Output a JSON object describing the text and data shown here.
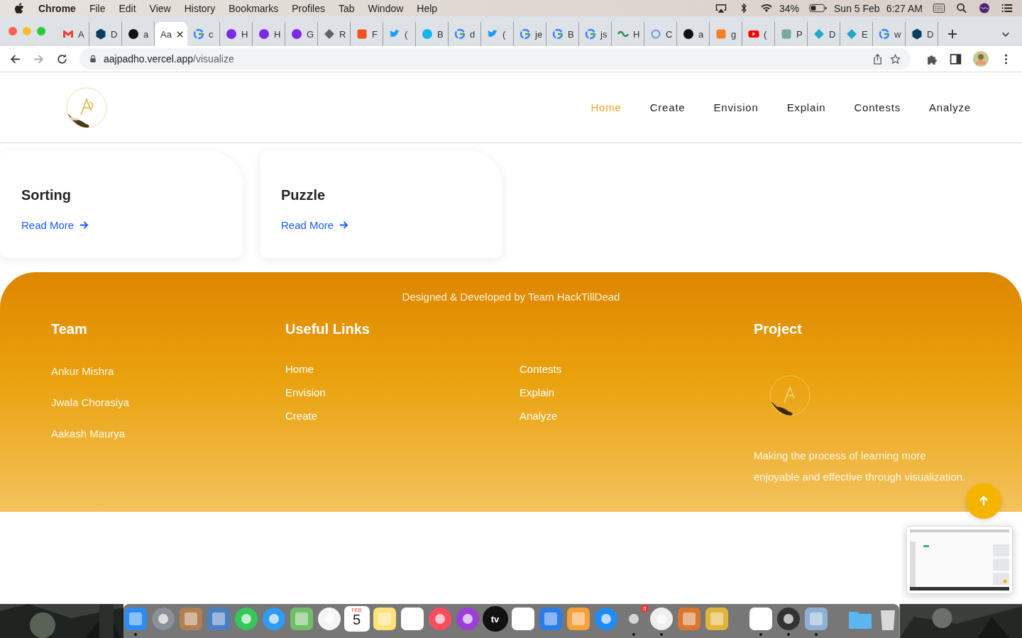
{
  "menu_bar": {
    "app": "Chrome",
    "menus": [
      "File",
      "Edit",
      "View",
      "History",
      "Bookmarks",
      "Profiles",
      "Tab",
      "Window",
      "Help"
    ],
    "battery": "34%",
    "date": "Sun 5 Feb",
    "time": "6:27 AM"
  },
  "tabs": [
    {
      "title": "A",
      "selected": false
    },
    {
      "title": "D",
      "selected": false
    },
    {
      "title": "a",
      "selected": false
    },
    {
      "title": "Aa",
      "selected": true
    },
    {
      "title": "c",
      "selected": false
    },
    {
      "title": "H",
      "selected": false
    },
    {
      "title": "H",
      "selected": false
    },
    {
      "title": "G",
      "selected": false
    },
    {
      "title": "R",
      "selected": false
    },
    {
      "title": "F",
      "selected": false
    },
    {
      "title": "(",
      "selected": false
    },
    {
      "title": "B",
      "selected": false
    },
    {
      "title": "d",
      "selected": false
    },
    {
      "title": "(",
      "selected": false
    },
    {
      "title": "je",
      "selected": false
    },
    {
      "title": "B",
      "selected": false
    },
    {
      "title": "js",
      "selected": false
    },
    {
      "title": "H",
      "selected": false
    },
    {
      "title": "C",
      "selected": false
    },
    {
      "title": "a",
      "selected": false
    },
    {
      "title": "g",
      "selected": false
    },
    {
      "title": "(",
      "selected": false
    },
    {
      "title": "P",
      "selected": false
    },
    {
      "title": "D",
      "selected": false
    },
    {
      "title": "E",
      "selected": false
    },
    {
      "title": "w",
      "selected": false
    },
    {
      "title": "D",
      "selected": false
    }
  ],
  "address_bar": {
    "domain": "aajpadho.vercel.app",
    "path": "/visualize"
  },
  "site_nav": [
    {
      "label": "Home",
      "selected": true
    },
    {
      "label": "Create",
      "selected": false
    },
    {
      "label": "Envision",
      "selected": false
    },
    {
      "label": "Explain",
      "selected": false
    },
    {
      "label": "Contests",
      "selected": false
    },
    {
      "label": "Analyze",
      "selected": false
    }
  ],
  "cards": [
    {
      "title": "Sorting",
      "link": "Read More"
    },
    {
      "title": "Puzzle",
      "link": "Read More"
    }
  ],
  "footer": {
    "credit": "Designed & Developed by Team HackTillDead",
    "team": {
      "heading": "Team",
      "members": [
        "Ankur Mishra",
        "Jwala Chorasiya",
        "Aakash Maurya"
      ]
    },
    "useful_links": {
      "heading": "Useful Links",
      "columns": [
        [
          "Home",
          "Envision",
          "Create"
        ],
        [
          "Contests",
          "Explain",
          "Analyze"
        ]
      ]
    },
    "project": {
      "heading": "Project",
      "description": "Making the process of learning more enjoyable and effective through visualization."
    }
  },
  "dock": [
    {
      "kind": "app",
      "running": true
    },
    {
      "kind": "app",
      "running": false
    },
    {
      "kind": "app",
      "running": false
    },
    {
      "kind": "app",
      "running": false
    },
    {
      "kind": "app",
      "running": false
    },
    {
      "kind": "app",
      "running": false
    },
    {
      "kind": "app",
      "running": false
    },
    {
      "kind": "app",
      "running": false
    },
    {
      "kind": "calendar",
      "month": "FEB",
      "day": "5",
      "running": false
    },
    {
      "kind": "app",
      "running": false
    },
    {
      "kind": "app",
      "running": false
    },
    {
      "kind": "app",
      "running": false
    },
    {
      "kind": "app",
      "running": false
    },
    {
      "kind": "tv",
      "label": "tv",
      "running": false
    },
    {
      "kind": "app",
      "running": false
    },
    {
      "kind": "app",
      "running": false
    },
    {
      "kind": "app",
      "running": false
    },
    {
      "kind": "app",
      "running": false
    },
    {
      "kind": "app",
      "badge": "3",
      "running": true
    },
    {
      "kind": "app",
      "running": true
    },
    {
      "kind": "app",
      "running": false
    },
    {
      "kind": "app",
      "running": false
    },
    {
      "kind": "separator"
    },
    {
      "kind": "app",
      "running": true
    },
    {
      "kind": "app",
      "running": true
    },
    {
      "kind": "app",
      "running": true
    },
    {
      "kind": "separator"
    },
    {
      "kind": "app",
      "running": false
    },
    {
      "kind": "app",
      "running": false
    }
  ]
}
